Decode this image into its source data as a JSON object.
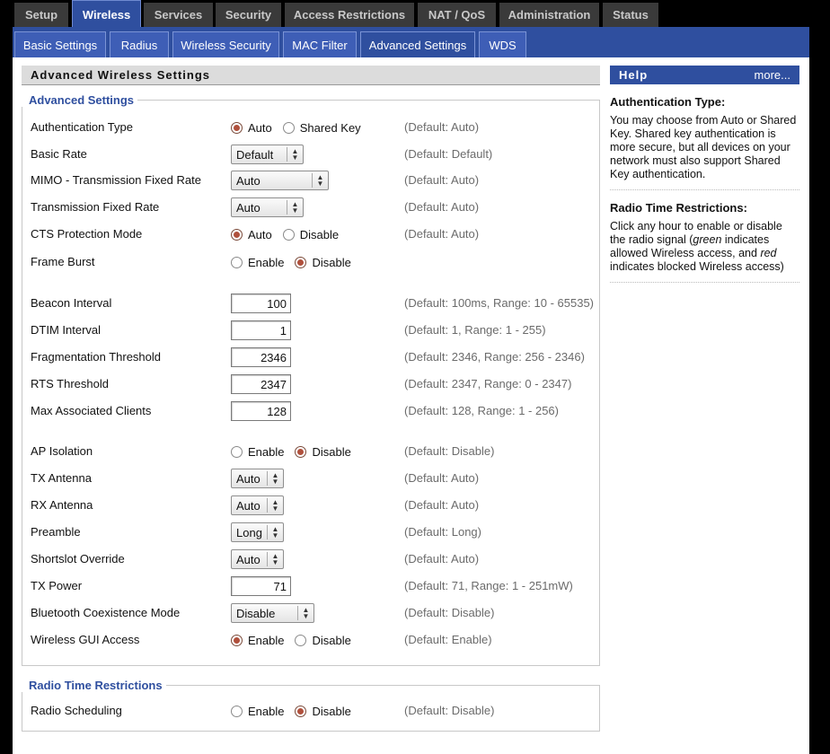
{
  "topnav": {
    "tabs": [
      "Setup",
      "Wireless",
      "Services",
      "Security",
      "Access Restrictions",
      "NAT / QoS",
      "Administration",
      "Status"
    ]
  },
  "subnav": {
    "tabs": [
      "Basic Settings",
      "Radius",
      "Wireless Security",
      "MAC Filter",
      "Advanced Settings",
      "WDS"
    ]
  },
  "page_title": "Advanced Wireless Settings",
  "advanced": {
    "legend": "Advanced Settings",
    "auth_type": {
      "label": "Authentication Type",
      "opt1": "Auto",
      "opt2": "Shared Key",
      "default": "(Default: Auto)"
    },
    "basic_rate": {
      "label": "Basic Rate",
      "value": "Default",
      "default": "(Default: Default)"
    },
    "mimo_rate": {
      "label": "MIMO - Transmission Fixed Rate",
      "value": "Auto",
      "default": "(Default: Auto)"
    },
    "tx_fixed_rate": {
      "label": "Transmission Fixed Rate",
      "value": "Auto",
      "default": "(Default: Auto)"
    },
    "cts": {
      "label": "CTS Protection Mode",
      "opt1": "Auto",
      "opt2": "Disable",
      "default": "(Default: Auto)"
    },
    "frame_burst": {
      "label": "Frame Burst",
      "opt1": "Enable",
      "opt2": "Disable"
    },
    "beacon": {
      "label": "Beacon Interval",
      "value": "100",
      "default": "(Default: 100ms, Range: 10 - 65535)"
    },
    "dtim": {
      "label": "DTIM Interval",
      "value": "1",
      "default": "(Default: 1, Range: 1 - 255)"
    },
    "frag": {
      "label": "Fragmentation Threshold",
      "value": "2346",
      "default": "(Default: 2346, Range: 256 - 2346)"
    },
    "rts": {
      "label": "RTS Threshold",
      "value": "2347",
      "default": "(Default: 2347, Range: 0 - 2347)"
    },
    "max_clients": {
      "label": "Max Associated Clients",
      "value": "128",
      "default": "(Default: 128, Range: 1 - 256)"
    },
    "ap_isolation": {
      "label": "AP Isolation",
      "opt1": "Enable",
      "opt2": "Disable",
      "default": "(Default: Disable)"
    },
    "tx_antenna": {
      "label": "TX Antenna",
      "value": "Auto",
      "default": "(Default: Auto)"
    },
    "rx_antenna": {
      "label": "RX Antenna",
      "value": "Auto",
      "default": "(Default: Auto)"
    },
    "preamble": {
      "label": "Preamble",
      "value": "Long",
      "default": "(Default: Long)"
    },
    "shortslot": {
      "label": "Shortslot Override",
      "value": "Auto",
      "default": "(Default: Auto)"
    },
    "tx_power": {
      "label": "TX Power",
      "value": "71",
      "default": "(Default: 71, Range: 1 - 251mW)"
    },
    "bluetooth": {
      "label": "Bluetooth Coexistence Mode",
      "value": "Disable",
      "default": "(Default: Disable)"
    },
    "gui_access": {
      "label": "Wireless GUI Access",
      "opt1": "Enable",
      "opt2": "Disable",
      "default": "(Default: Enable)"
    }
  },
  "radio_time": {
    "legend": "Radio Time Restrictions",
    "scheduling": {
      "label": "Radio Scheduling",
      "opt1": "Enable",
      "opt2": "Disable",
      "default": "(Default: Disable)"
    }
  },
  "help": {
    "title": "Help",
    "more": "more...",
    "auth_heading": "Authentication Type:",
    "auth_text": "You may choose from Auto or Shared Key. Shared key authentication is more secure, but all devices on your network must also support Shared Key authentication.",
    "radio_heading": "Radio Time Restrictions:",
    "radio_text_1": "Click any hour to enable or disable the radio signal (",
    "radio_green": "green",
    "radio_text_2": " indicates allowed Wireless access, and ",
    "radio_red": "red",
    "radio_text_3": " indicates blocked Wireless access)"
  }
}
